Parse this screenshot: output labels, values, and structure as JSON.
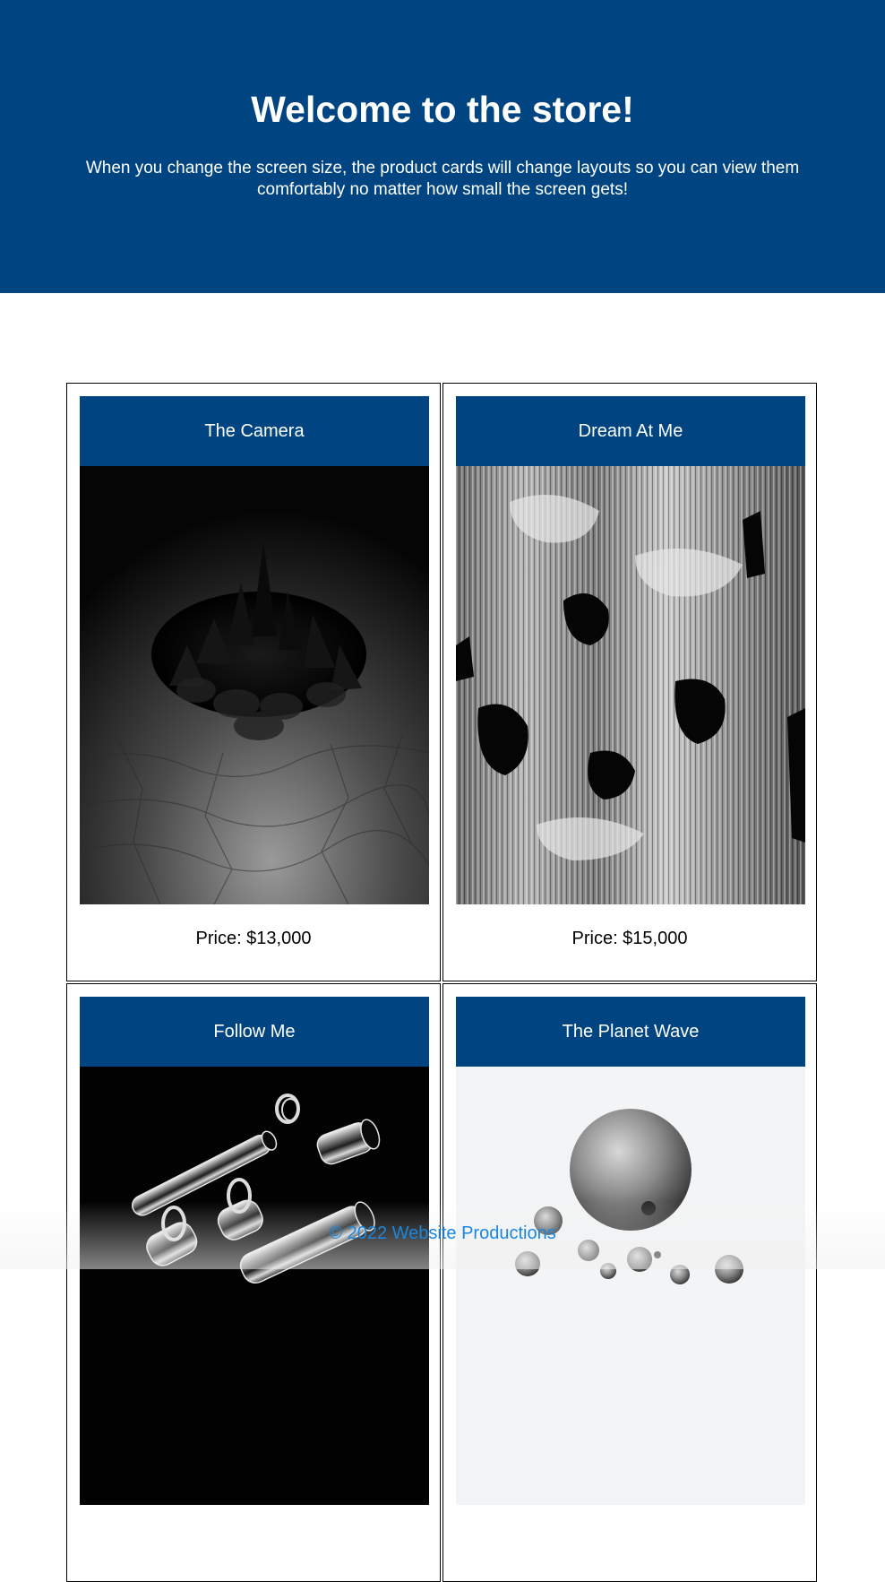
{
  "hero": {
    "title": "Welcome to the store!",
    "subtitle": "When you change the screen size, the product cards will change layouts so you can view them comfortably no matter how small the screen gets!"
  },
  "products": [
    {
      "title": "The Camera",
      "price": "Price: $13,000",
      "image": "black-spiked-terrain-image"
    },
    {
      "title": "Dream At Me",
      "price": "Price: $15,000",
      "image": "glitch-texture-image"
    },
    {
      "title": "Follow Me",
      "price": "",
      "image": "metal-tubes-image"
    },
    {
      "title": "The Planet Wave",
      "price": "",
      "image": "spheres-image"
    }
  ],
  "footer": {
    "text": "© 2022 Website Productions"
  },
  "colors": {
    "brand": "#004581",
    "link": "#1a86e0"
  }
}
